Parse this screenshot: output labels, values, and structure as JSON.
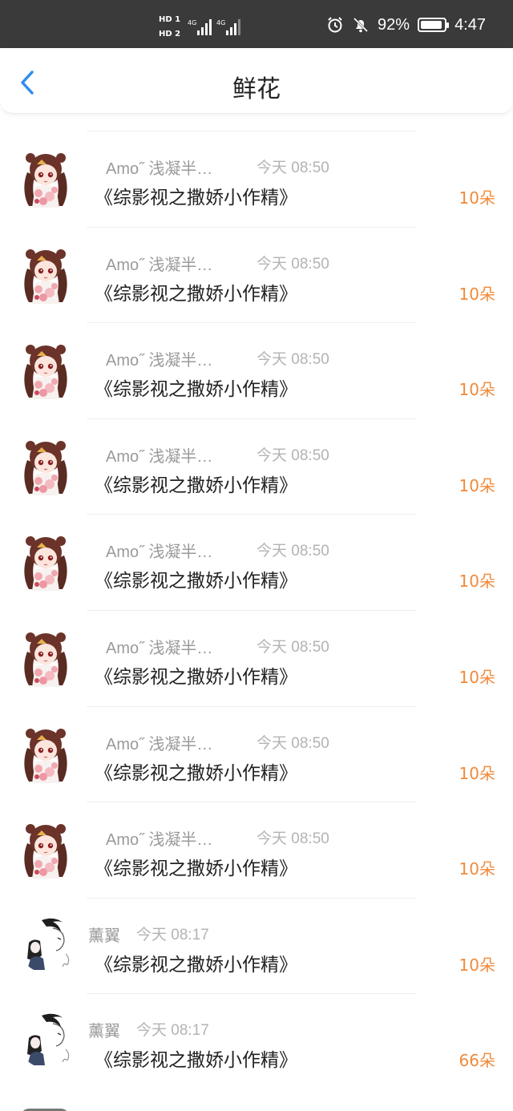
{
  "status_bar": {
    "hd1": "HD 1",
    "hd2": "HD 2",
    "net1": "4G",
    "net2": "4G",
    "battery_percent": "92%",
    "battery_level": 0.92,
    "time": "4:47",
    "icons": [
      "alarm-icon",
      "bell-off-icon",
      "battery-icon"
    ]
  },
  "header": {
    "title": "鲜花",
    "back_icon": "chevron-left-icon",
    "accent_color": "#2f8cef"
  },
  "colors": {
    "count_color": "#f08a3a",
    "meta_color": "#9a9a9a"
  },
  "rows": [
    {
      "name": "Amo˝ 浅凝半…",
      "time": "今天 08:50",
      "book": "《综影视之撒娇小作精》",
      "count": "10朵",
      "avatar": "anime-girl-avatar"
    },
    {
      "name": "Amo˝ 浅凝半…",
      "time": "今天 08:50",
      "book": "《综影视之撒娇小作精》",
      "count": "10朵",
      "avatar": "anime-girl-avatar"
    },
    {
      "name": "Amo˝ 浅凝半…",
      "time": "今天 08:50",
      "book": "《综影视之撒娇小作精》",
      "count": "10朵",
      "avatar": "anime-girl-avatar"
    },
    {
      "name": "Amo˝ 浅凝半…",
      "time": "今天 08:50",
      "book": "《综影视之撒娇小作精》",
      "count": "10朵",
      "avatar": "anime-girl-avatar"
    },
    {
      "name": "Amo˝ 浅凝半…",
      "time": "今天 08:50",
      "book": "《综影视之撒娇小作精》",
      "count": "10朵",
      "avatar": "anime-girl-avatar"
    },
    {
      "name": "Amo˝ 浅凝半…",
      "time": "今天 08:50",
      "book": "《综影视之撒娇小作精》",
      "count": "10朵",
      "avatar": "anime-girl-avatar"
    },
    {
      "name": "Amo˝ 浅凝半…",
      "time": "今天 08:50",
      "book": "《综影视之撒娇小作精》",
      "count": "10朵",
      "avatar": "anime-girl-avatar"
    },
    {
      "name": "Amo˝ 浅凝半…",
      "time": "今天 08:50",
      "book": "《综影视之撒娇小作精》",
      "count": "10朵",
      "avatar": "anime-girl-avatar"
    },
    {
      "name": "薰翼",
      "time": "今天 08:17",
      "book": "《综影视之撒娇小作精》",
      "count": "10朵",
      "avatar": "sketch-couple-avatar"
    },
    {
      "name": "薰翼",
      "time": "今天 08:17",
      "book": "《综影视之撒娇小作精》",
      "count": "66朵",
      "avatar": "sketch-couple-avatar"
    }
  ]
}
